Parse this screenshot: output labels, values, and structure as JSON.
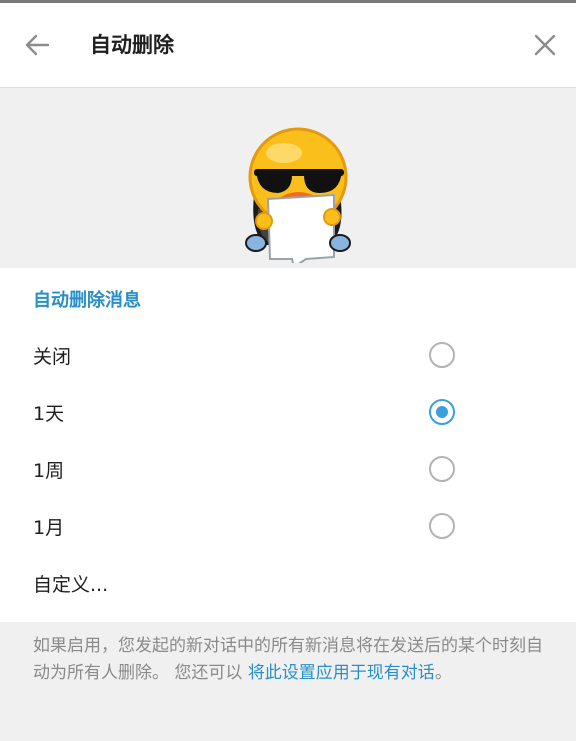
{
  "header": {
    "title": "自动删除",
    "back_icon": "arrow-left-icon",
    "close_icon": "close-icon"
  },
  "hero": {
    "sticker": "duck-sunglasses-sticker"
  },
  "section_title": "自动删除消息",
  "options": [
    {
      "label": "关闭",
      "selected": false
    },
    {
      "label": "1天",
      "selected": true
    },
    {
      "label": "1周",
      "selected": false
    },
    {
      "label": "1月",
      "selected": false
    }
  ],
  "custom_label": "自定义...",
  "footer": {
    "text_before_link": "如果启用，您发起的新对话中的所有新消息将在发送后的某个时刻自动为所有人删除。 您还可以 ",
    "link": "将此设置应用于现有对话",
    "text_after_link": "。"
  },
  "colors": {
    "accent": "#3aa0dc",
    "section": "#2a8fc8",
    "text": "#1f1f1f",
    "muted": "#8a8a8a",
    "background": "#f0f0f0"
  }
}
